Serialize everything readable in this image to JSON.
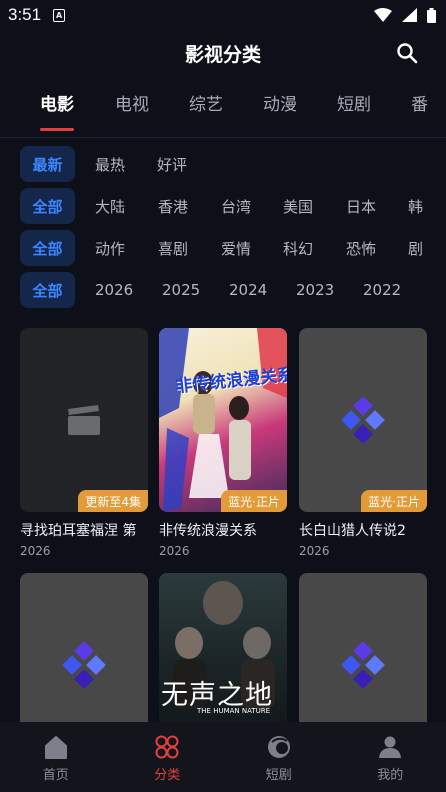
{
  "status_bar": {
    "time": "3:51",
    "notification_letter": "A"
  },
  "header": {
    "title": "影视分类"
  },
  "main_tabs": [
    "电影",
    "电视",
    "综艺",
    "动漫",
    "短剧",
    "番"
  ],
  "filters": {
    "sort": [
      "最新",
      "最热",
      "好评"
    ],
    "region_all": "全部",
    "regions": [
      "大陆",
      "香港",
      "台湾",
      "美国",
      "日本",
      "韩"
    ],
    "genre_all": "全部",
    "genres": [
      "动作",
      "喜剧",
      "爱情",
      "科幻",
      "恐怖",
      "剧"
    ],
    "year_all": "全部",
    "years": [
      "2026",
      "2025",
      "2024",
      "2023",
      "2022"
    ]
  },
  "cards": [
    {
      "title": "寻找珀耳塞福涅 第",
      "year": "2026",
      "badge": "更新至4集",
      "poster": "clapper-icon"
    },
    {
      "title": "非传统浪漫关系",
      "year": "2026",
      "badge": "蓝光·正片",
      "poster_title": "非传统浪漫关系",
      "poster": "poster-art"
    },
    {
      "title": "长白山猎人传说2",
      "year": "2026",
      "badge": "蓝光·正片",
      "poster": "diamond-logo-icon"
    },
    {
      "poster": "diamond-logo-icon"
    },
    {
      "poster_title": "无声之地",
      "poster_subtitle": "THE HUMAN NATURE",
      "poster": "poster-art"
    },
    {
      "poster": "diamond-logo-icon"
    }
  ],
  "bottom_nav": [
    {
      "label": "首页",
      "icon": "home-icon"
    },
    {
      "label": "分类",
      "icon": "category-icon",
      "active": true
    },
    {
      "label": "短剧",
      "icon": "short-drama-icon"
    },
    {
      "label": "我的",
      "icon": "profile-icon"
    }
  ],
  "colors": {
    "accent_red": "#e2413f",
    "accent_blue": "#3b86ff",
    "badge_orange": "#e39a38"
  }
}
